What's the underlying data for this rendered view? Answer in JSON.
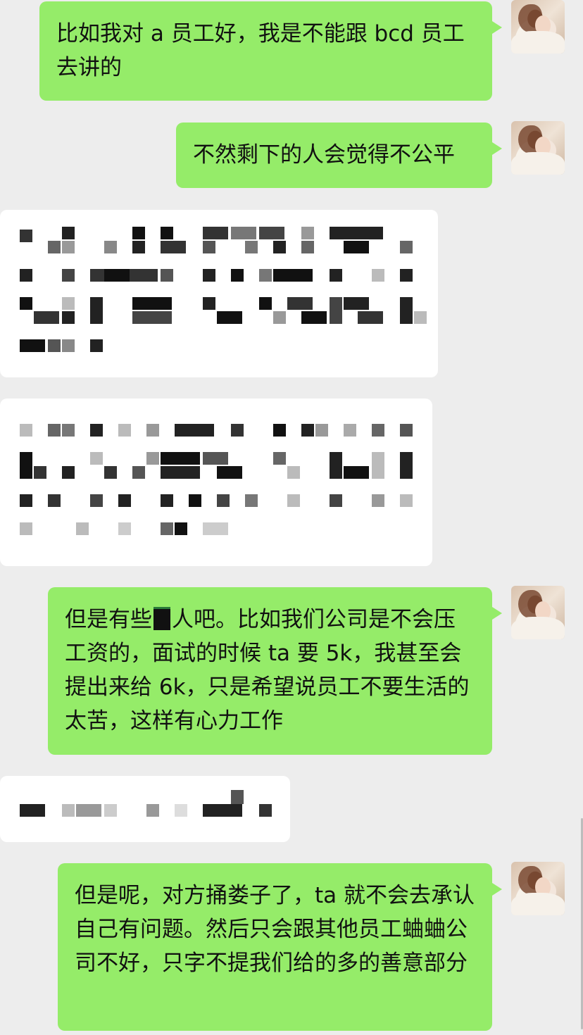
{
  "chat": {
    "messages": [
      {
        "side": "me",
        "text": "比如我对 a 员工好，我是不能跟 bcd 员工去讲的"
      },
      {
        "side": "me",
        "text": "不然剩下的人会觉得不公平"
      },
      {
        "side": "other",
        "redacted": true
      },
      {
        "side": "other",
        "redacted": true
      },
      {
        "side": "me",
        "text_before": "但是有些",
        "text_after": "人吧。比如我们公司是不会压工资的，面试的时候 ta 要 5k，我甚至会提出来给 6k，只是希望说员工不要生活的太苦，这样有心力工作"
      },
      {
        "side": "other",
        "redacted": true
      },
      {
        "side": "me",
        "text": "但是呢，对方捅娄子了，ta 就不会去承认自己有问题。然后只会跟其他员工蛐蛐公司不好，只字不提我们给的多的善意部分"
      }
    ]
  },
  "icons": {
    "avatar": "avatar-icon"
  },
  "colors": {
    "background": "#ededed",
    "my_bubble": "#95ec69",
    "other_bubble": "#ffffff"
  }
}
